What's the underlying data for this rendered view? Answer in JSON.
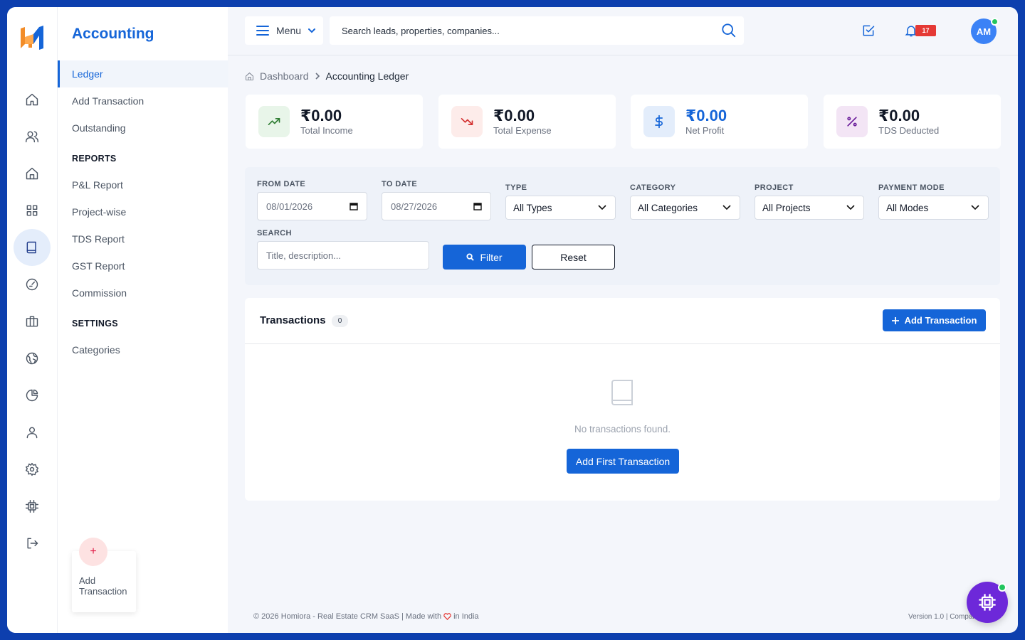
{
  "app": {
    "logo_letters": "H"
  },
  "sidebar": {
    "title": "Accounting",
    "items": [
      {
        "label": "Ledger"
      },
      {
        "label": "Add Transaction"
      },
      {
        "label": "Outstanding"
      }
    ],
    "reports_heading": "REPORTS",
    "reports": [
      {
        "label": "P&L Report"
      },
      {
        "label": "Project-wise"
      },
      {
        "label": "TDS Report"
      },
      {
        "label": "GST Report"
      },
      {
        "label": "Commission"
      }
    ],
    "settings_heading": "SETTINGS",
    "settings": [
      {
        "label": "Categories"
      }
    ],
    "fab_icon": "+",
    "fab_label": "Add Transaction"
  },
  "rail": {
    "icons": [
      "home-icon",
      "users-icon",
      "property-icon",
      "grid-icon",
      "book-icon",
      "gauge-icon",
      "briefcase-icon",
      "globe-icon",
      "pie-chart-icon",
      "user-icon",
      "settings-icon",
      "chip-icon",
      "logout-icon"
    ],
    "active": "book-icon"
  },
  "topbar": {
    "menu_label": "Menu",
    "search_placeholder": "Search leads, properties, companies...",
    "notification_count": "17",
    "avatar_initials": "AM"
  },
  "breadcrumb": {
    "home": "Dashboard",
    "current": "Accounting Ledger"
  },
  "stats": [
    {
      "value": "₹0.00",
      "label": "Total Income",
      "icon": "trending-up-icon",
      "color": "#2e7d32",
      "bg": "#e8f5e9"
    },
    {
      "value": "₹0.00",
      "label": "Total Expense",
      "icon": "trending-down-icon",
      "color": "#d32f2f",
      "bg": "#fdecea"
    },
    {
      "value": "₹0.00",
      "label": "Net Profit",
      "icon": "dollar-icon",
      "color": "#1565d8",
      "bg": "#e3edfb"
    },
    {
      "value": "₹0.00",
      "label": "TDS Deducted",
      "icon": "percent-icon",
      "color": "#6a1b9a",
      "bg": "#f3e5f5"
    }
  ],
  "filters": {
    "from_date_label": "FROM DATE",
    "from_date": "08/01/2026",
    "to_date_label": "TO DATE",
    "to_date": "08/27/2026",
    "type_label": "TYPE",
    "type_value": "All Types",
    "category_label": "CATEGORY",
    "category_value": "All Categories",
    "project_label": "PROJECT",
    "project_value": "All Projects",
    "payment_label": "PAYMENT MODE",
    "payment_value": "All Modes",
    "search_label": "SEARCH",
    "search_placeholder": "Title, description...",
    "filter_button": "Filter",
    "reset_button": "Reset"
  },
  "transactions": {
    "title": "Transactions",
    "count": "0",
    "add_button": "Add Transaction",
    "empty_text": "No transactions found.",
    "first_button": "Add First Transaction"
  },
  "footer": {
    "left_before": "© 2026 Homiora - Real Estate CRM SaaS | Made with",
    "left_after": "in India",
    "right": "Version 1.0 | Company"
  }
}
